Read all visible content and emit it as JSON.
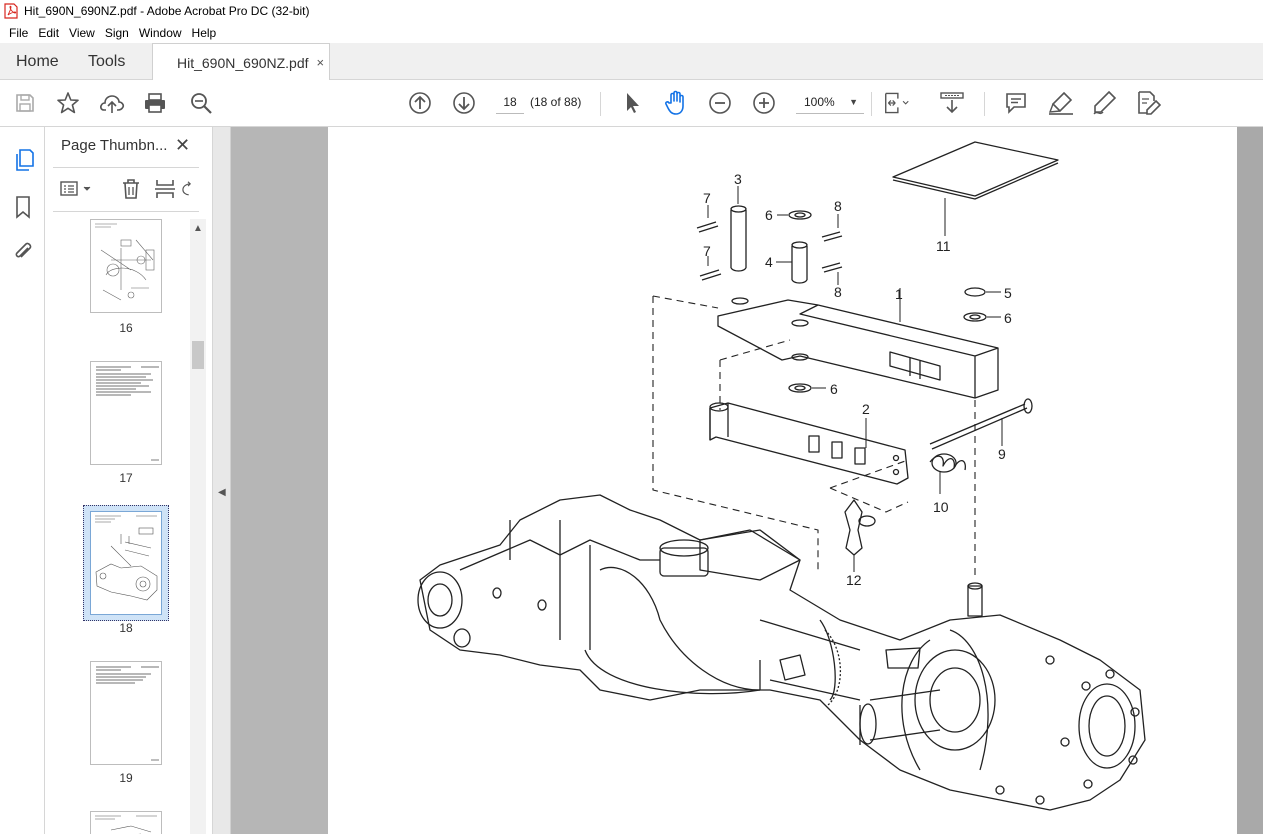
{
  "window": {
    "title": "Hit_690N_690NZ.pdf - Adobe Acrobat Pro DC (32-bit)"
  },
  "menu": [
    "File",
    "Edit",
    "View",
    "Sign",
    "Window",
    "Help"
  ],
  "tabs": {
    "home": "Home",
    "tools": "Tools",
    "document": "Hit_690N_690NZ.pdf",
    "close": "×"
  },
  "toolbar": {
    "page_current": "18",
    "page_count": "(18 of 88)",
    "zoom": "100%",
    "icons": [
      "save-icon",
      "star-icon",
      "upload-icon",
      "print-icon",
      "zoom-search-icon",
      "page-up-icon",
      "page-down-icon",
      "select-cursor-icon",
      "hand-icon",
      "zoom-out-icon",
      "zoom-in-icon",
      "fit-page-icon",
      "scroll-mode-icon",
      "comment-icon",
      "highlight-icon",
      "sign-icon",
      "edit-pdf-icon"
    ]
  },
  "panel": {
    "title": "Page Thumbn...",
    "close": "✕",
    "thumbnails": [
      {
        "label": "16",
        "selected": false
      },
      {
        "label": "17",
        "selected": false
      },
      {
        "label": "18",
        "selected": true
      },
      {
        "label": "19",
        "selected": false
      }
    ]
  },
  "diagram": {
    "callouts": [
      "1",
      "2",
      "3",
      "4",
      "5",
      "6",
      "6",
      "6",
      "7",
      "7",
      "8",
      "8",
      "9",
      "10",
      "11",
      "12"
    ]
  },
  "colors": {
    "accent": "#1473e6",
    "pdf_icon_red": "#d7261e",
    "viewer_bg": "#b6b6b6"
  }
}
